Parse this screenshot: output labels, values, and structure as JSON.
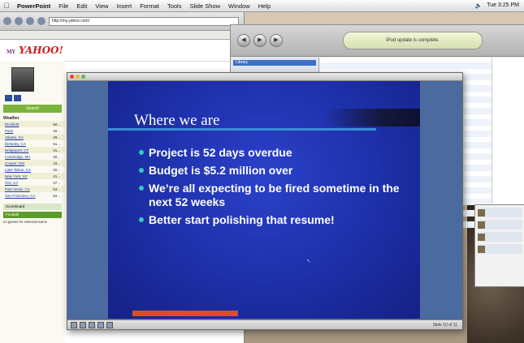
{
  "menubar": {
    "app": "PowerPoint",
    "items": [
      "File",
      "Edit",
      "View",
      "Insert",
      "Format",
      "Tools",
      "Slide Show",
      "Window",
      "Help"
    ],
    "clock": "Tue 3:25 PM"
  },
  "browser": {
    "url": "http://my.yahoo.com/",
    "logo": "YAHOO!",
    "logo_prefix": "MY",
    "search_label": "Search",
    "weather_title": "Weather",
    "weather": [
      {
        "city": "Richfield",
        "temp": "50..."
      },
      {
        "city": "Paris",
        "temp": "32..."
      },
      {
        "city": "Atlanta, GA",
        "temp": "29..."
      },
      {
        "city": "Berkeley, CA",
        "temp": "51..."
      },
      {
        "city": "Bridgeport, CT",
        "temp": "31..."
      },
      {
        "city": "Cambridge, MA",
        "temp": "32..."
      },
      {
        "city": "Cooper, MO",
        "temp": "19..."
      },
      {
        "city": "Lake Tahoe, CA",
        "temp": "32..."
      },
      {
        "city": "New York, NY",
        "temp": "41..."
      },
      {
        "city": "Ord, CA",
        "temp": "47..."
      },
      {
        "city": "Palo Verde, CA",
        "temp": "53..."
      },
      {
        "city": "San Francisco, CA",
        "temp": "54..."
      }
    ],
    "footer_box": "Scoreboard",
    "footer_green": "Football",
    "footer_note": "no games for selected teams"
  },
  "itunes": {
    "lcd": "iPod update is complete.",
    "source_selected": "Library"
  },
  "ppt": {
    "slide": {
      "title": "Where we are",
      "bullets": [
        "Project is 52 days overdue",
        "Budget is $5.2 million over",
        "We’re all expecting to be fired sometime in the next 52 weeks",
        "Better start polishing that resume!"
      ]
    },
    "status": "Slide 10 of 11"
  }
}
